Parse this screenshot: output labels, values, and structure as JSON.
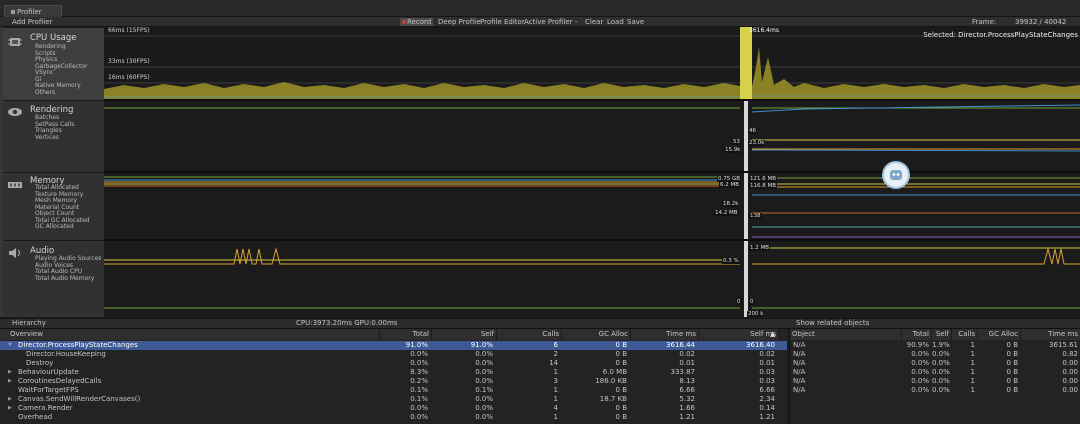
{
  "window": {
    "tab_title": "Profiler"
  },
  "toolbar": {
    "add_profiler": "Add Profiler",
    "record": "Record",
    "deep_profile": "Deep Profile",
    "profile_editor": "Profile Editor",
    "active_profiler": "Active Profiler",
    "separator": "-",
    "clear": "Clear",
    "load": "Load",
    "save": "Save",
    "frame_label": "Frame:",
    "frame_value": "39932 / 40042"
  },
  "modules": [
    {
      "title": "CPU Usage",
      "legend": [
        {
          "label": "Rendering",
          "color": "#6fa53a"
        },
        {
          "label": "Scripts",
          "color": "#3f8fd0"
        },
        {
          "label": "Physics",
          "color": "#d9a031"
        },
        {
          "label": "GarbageCollector",
          "color": "#1f6db5"
        },
        {
          "label": "VSync",
          "color": "#d6c440"
        },
        {
          "label": "Gi",
          "color": "#a9a9a9"
        },
        {
          "label": "Native Memory",
          "color": "#5a9ea3"
        },
        {
          "label": "Others",
          "color": "#8b5fb3"
        }
      ]
    },
    {
      "title": "Rendering",
      "legend": [
        {
          "label": "Batches",
          "color": "#6fa53a"
        },
        {
          "label": "SetPass Calls",
          "color": "#3f8fd0"
        },
        {
          "label": "Triangles",
          "color": "#d9a031"
        },
        {
          "label": "Vertices",
          "color": "#d6c440"
        }
      ]
    },
    {
      "title": "Memory",
      "legend": [
        {
          "label": "Total Allocated",
          "color": "#6fa53a"
        },
        {
          "label": "Texture Memory",
          "color": "#3f8fd0"
        },
        {
          "label": "Mesh Memory",
          "color": "#d9a031"
        },
        {
          "label": "Material Count",
          "color": "#d6c440"
        },
        {
          "label": "Object Count",
          "color": "#c56a2b"
        },
        {
          "label": "Total GC Allocated",
          "color": "#5a9ea3"
        },
        {
          "label": "GC Allocated",
          "color": "#8b5fb3"
        }
      ]
    },
    {
      "title": "Audio",
      "legend": [
        {
          "label": "Playing Audio Sources",
          "color": "#6fa53a"
        },
        {
          "label": "Audio Voices",
          "color": "#3f8fd0"
        },
        {
          "label": "Total Audio CPU",
          "color": "#d9a031"
        },
        {
          "label": "Total Audio Memory",
          "color": "#d6c440"
        }
      ]
    }
  ],
  "graph": {
    "cpu_axis": [
      "66ms (15FPS)",
      "33ms (30FPS)",
      "16ms (60FPS)"
    ],
    "selected_label": "Selected: Director.ProcessPlayStateChanges",
    "cursor_cpu": "3616.4ms",
    "rendering_values": [
      "46",
      "53",
      "23.0k",
      "15.9k"
    ],
    "memory_values": [
      "0.75 GB",
      "121.6 MB",
      "6.2 MB",
      "116.8 MB",
      "18.2k",
      "14.2 MB",
      "138"
    ],
    "audio_values": [
      "1.2 MB",
      "0.3 %",
      "0",
      "0",
      "200 k"
    ]
  },
  "hierarchy": {
    "dropdown": "Hierarchy",
    "cpu_gpu": "CPU:3973.20ms   GPU:0.00ms",
    "related": "Show related objects",
    "columns": [
      "Overview",
      "Total",
      "Self",
      "Calls",
      "GC Alloc",
      "Time ms",
      "Self ms"
    ],
    "rows": [
      {
        "name": "Director.ProcessPlayStateChanges",
        "total": "91.0%",
        "self": "91.0%",
        "calls": "6",
        "gc": "0 B",
        "time": "3616.44",
        "selfms": "3616.40"
      },
      {
        "name": "Director.HouseKeeping",
        "total": "0.0%",
        "self": "0.0%",
        "calls": "2",
        "gc": "0 B",
        "time": "0.02",
        "selfms": "0.02"
      },
      {
        "name": "Destroy",
        "total": "0.0%",
        "self": "0.0%",
        "calls": "14",
        "gc": "0 B",
        "time": "0.01",
        "selfms": "0.01"
      },
      {
        "name": "BehaviourUpdate",
        "total": "8.3%",
        "self": "0.0%",
        "calls": "1",
        "gc": "6.0 MB",
        "time": "333.87",
        "selfms": "0.03"
      },
      {
        "name": "CoroutinesDelayedCalls",
        "total": "0.2%",
        "self": "0.0%",
        "calls": "3",
        "gc": "186.0 KB",
        "time": "8.13",
        "selfms": "0.03"
      },
      {
        "name": "WaitForTargetFPS",
        "total": "0.1%",
        "self": "0.1%",
        "calls": "1",
        "gc": "0 B",
        "time": "6.66",
        "selfms": "6.66"
      },
      {
        "name": "Canvas.SendWillRenderCanvases()",
        "total": "0.1%",
        "self": "0.0%",
        "calls": "1",
        "gc": "18.7 KB",
        "time": "5.32",
        "selfms": "2.34"
      },
      {
        "name": "Camera.Render",
        "total": "0.0%",
        "self": "0.0%",
        "calls": "4",
        "gc": "0 B",
        "time": "1.66",
        "selfms": "0.14"
      },
      {
        "name": "Overhead",
        "total": "0.0%",
        "self": "0.0%",
        "calls": "1",
        "gc": "0 B",
        "time": "1.21",
        "selfms": "1.21"
      }
    ],
    "object_columns": [
      "Object",
      "Total",
      "Self",
      "Calls",
      "GC Alloc",
      "Time ms"
    ],
    "object_rows": [
      {
        "object": "N/A",
        "total": "90.9%",
        "self": "1.9%",
        "calls": "1",
        "gc": "0 B",
        "time": "3615.61"
      },
      {
        "object": "N/A",
        "total": "0.0%",
        "self": "0.0%",
        "calls": "1",
        "gc": "0 B",
        "time": "0.82"
      },
      {
        "object": "N/A",
        "total": "0.0%",
        "self": "0.0%",
        "calls": "1",
        "gc": "0 B",
        "time": "0.00"
      },
      {
        "object": "N/A",
        "total": "0.0%",
        "self": "0.0%",
        "calls": "1",
        "gc": "0 B",
        "time": "0.00"
      },
      {
        "object": "N/A",
        "total": "0.0%",
        "self": "0.0%",
        "calls": "1",
        "gc": "0 B",
        "time": "0.00"
      },
      {
        "object": "N/A",
        "total": "0.0%",
        "self": "0.0%",
        "calls": "1",
        "gc": "0 B",
        "time": "0.00"
      }
    ]
  }
}
